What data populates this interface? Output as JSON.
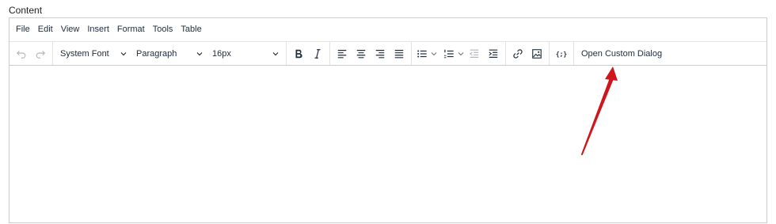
{
  "label": "Content",
  "menubar": {
    "items": [
      "File",
      "Edit",
      "View",
      "Insert",
      "Format",
      "Tools",
      "Table"
    ]
  },
  "toolbar": {
    "font_family": "System Font",
    "block_format": "Paragraph",
    "font_size": "16px",
    "custom_dialog_label": "Open Custom Dialog",
    "icons": [
      "undo-icon",
      "redo-icon",
      "bold-icon",
      "italic-icon",
      "align-left-icon",
      "align-center-icon",
      "align-right-icon",
      "align-justify-icon",
      "bullet-list-icon",
      "numbered-list-icon",
      "outdent-icon",
      "indent-icon",
      "link-icon",
      "image-icon",
      "code-sample-icon"
    ]
  },
  "annotation": {
    "arrow_color": "#d0161b"
  }
}
